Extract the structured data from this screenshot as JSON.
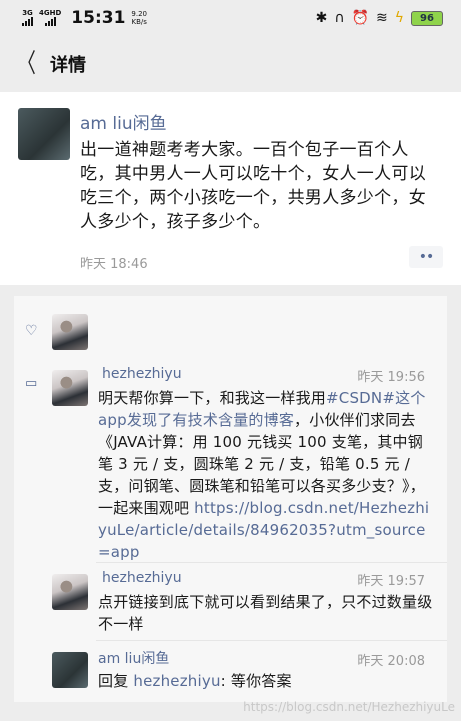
{
  "status_bar": {
    "net1": "3G",
    "net2": "4GHD",
    "time": "15:31",
    "speed_value": "9.20",
    "speed_unit": "KB/s",
    "battery": "96",
    "icons": [
      "bluetooth-icon",
      "headphones-icon",
      "alarm-icon",
      "wifi-icon",
      "charging-icon"
    ]
  },
  "header": {
    "title": "详情",
    "back_icon": "back-chevron-icon"
  },
  "post": {
    "author": "am  liu闲鱼",
    "text": "出一道神题考考大家。一百个包子一百个人吃，其中男人一人可以吃十个，女人一人可以吃三个，两个小孩吃一个，共男人多少个，女人多少个，孩子多少个。",
    "time": "昨天 18:46",
    "more_label": "••"
  },
  "comments": [
    {
      "author": "hezhezhiyu",
      "time": "昨天 19:56",
      "text_a": "明天帮你算一下，和我这一样我用",
      "hashtag": "#CSDN#这个app发现了有技术含量的博客",
      "text_b": "，小伙伴们求同去《JAVA计算：用 100 元钱买 100 支笔，其中钢笔 3 元 / 支，圆珠笔 2 元 / 支，铅笔 0.5 元 / 支，问钢笔、圆珠笔和铅笔可以各买多少支？》，一起来围观吧 ",
      "url": "https://blog.csdn.net/HezhezhiyuLe/article/details/84962035?utm_source=app"
    },
    {
      "author": "hezhezhiyu",
      "time": "昨天 19:57",
      "text": "点开链接到底下就可以看到结果了，只不过数量级不一样"
    },
    {
      "author": "am  liu闲鱼",
      "time": "昨天 20:08",
      "reply_prefix": "回复 ",
      "reply_to": "hezhezhiyu",
      "text": ": 等你答案"
    }
  ],
  "watermark": "https://blog.csdn.net/HezhezhiyuLe"
}
